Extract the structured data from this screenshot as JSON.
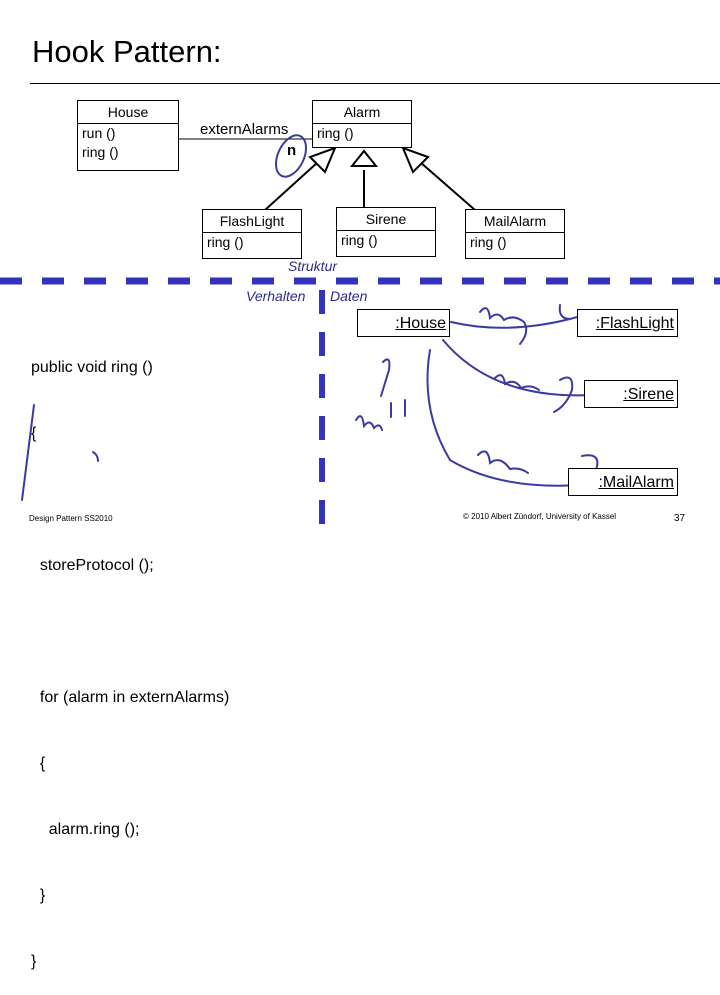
{
  "slide": {
    "title": "Hook Pattern:",
    "section_labels": {
      "structure": "Struktur",
      "behavior": "Verhalten",
      "data": "Daten"
    },
    "class_diagram": {
      "house": {
        "name": "House",
        "ops": [
          "run ()",
          "ring ()"
        ]
      },
      "alarm": {
        "name": "Alarm",
        "ops": [
          "ring ()"
        ]
      },
      "association": {
        "role": "externAlarms",
        "multiplicity": "n"
      },
      "subclasses": [
        {
          "name": "FlashLight",
          "ops": [
            "ring ()"
          ]
        },
        {
          "name": "Sirene",
          "ops": [
            "ring ()"
          ]
        },
        {
          "name": "MailAlarm",
          "ops": [
            "ring ()"
          ]
        }
      ]
    },
    "code": {
      "lines": [
        "public void ring ()",
        "{",
        "",
        "  storeProtocol ();",
        "",
        "  for (alarm in externAlarms)",
        "  {",
        "    alarm.ring ();",
        "  }",
        "}"
      ]
    },
    "object_diagram": {
      "house": ":House",
      "flashlight": ":FlashLight",
      "sirene": ":Sirene",
      "mailalarm": ":MailAlarm"
    },
    "footer": {
      "left": "Design Pattern SS2010",
      "center": "© 2010 Albert Zündorf, University of Kassel",
      "page": "37"
    },
    "colors": {
      "annotation": "#3a3aa0",
      "divider": "#3333bb"
    }
  }
}
